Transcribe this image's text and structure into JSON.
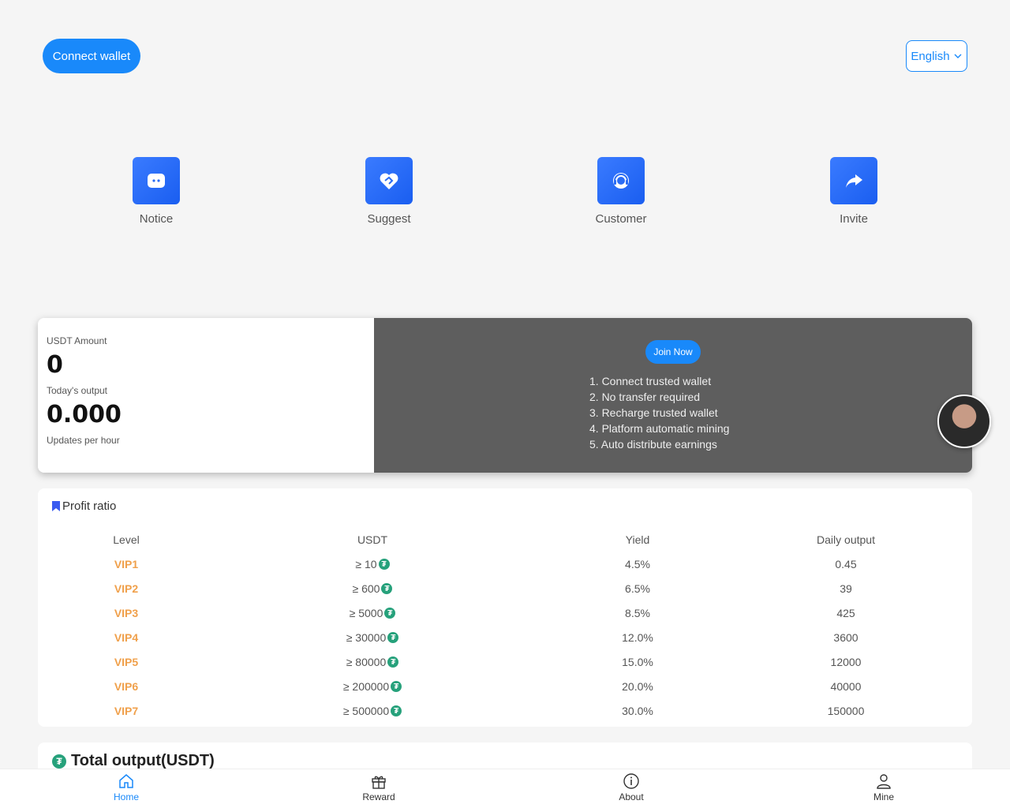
{
  "header": {
    "connect_label": "Connect wallet",
    "language_label": "English"
  },
  "quick_actions": [
    {
      "label": "Notice",
      "icon": "chat-bubble-icon"
    },
    {
      "label": "Suggest",
      "icon": "handshake-heart-icon"
    },
    {
      "label": "Customer",
      "icon": "headset-icon"
    },
    {
      "label": "Invite",
      "icon": "share-arrow-icon"
    }
  ],
  "summary": {
    "usdt_amount_label": "USDT Amount",
    "usdt_amount_value": "0",
    "today_output_label": "Today's output",
    "today_output_value": "0.000",
    "updates_label": "Updates per hour",
    "join_label": "Join Now",
    "steps": [
      "1. Connect trusted wallet",
      "2. No transfer required",
      "3. Recharge trusted wallet",
      "4. Platform automatic mining",
      "5. Auto distribute earnings"
    ]
  },
  "profit": {
    "title": "Profit ratio",
    "headers": {
      "level": "Level",
      "usdt": "USDT",
      "yield": "Yield",
      "daily": "Daily output"
    },
    "rows": [
      {
        "level": "VIP1",
        "usdt": "≥ 10",
        "yield": "4.5%",
        "daily": "0.45"
      },
      {
        "level": "VIP2",
        "usdt": "≥ 600",
        "yield": "6.5%",
        "daily": "39"
      },
      {
        "level": "VIP3",
        "usdt": "≥ 5000",
        "yield": "8.5%",
        "daily": "425"
      },
      {
        "level": "VIP4",
        "usdt": "≥ 30000",
        "yield": "12.0%",
        "daily": "3600"
      },
      {
        "level": "VIP5",
        "usdt": "≥ 80000",
        "yield": "15.0%",
        "daily": "12000"
      },
      {
        "level": "VIP6",
        "usdt": "≥ 200000",
        "yield": "20.0%",
        "daily": "40000"
      },
      {
        "level": "VIP7",
        "usdt": "≥ 500000",
        "yield": "30.0%",
        "daily": "150000"
      }
    ]
  },
  "total": {
    "title": "Total output(USDT)"
  },
  "tabbar": [
    {
      "label": "Home",
      "icon": "home-icon",
      "active": true
    },
    {
      "label": "Reward",
      "icon": "gift-icon",
      "active": false
    },
    {
      "label": "About",
      "icon": "info-icon",
      "active": false
    },
    {
      "label": "Mine",
      "icon": "user-icon",
      "active": false
    }
  ],
  "colors": {
    "accent": "#1989fa",
    "vip": "#f0a04b",
    "tether": "#26a17b"
  }
}
